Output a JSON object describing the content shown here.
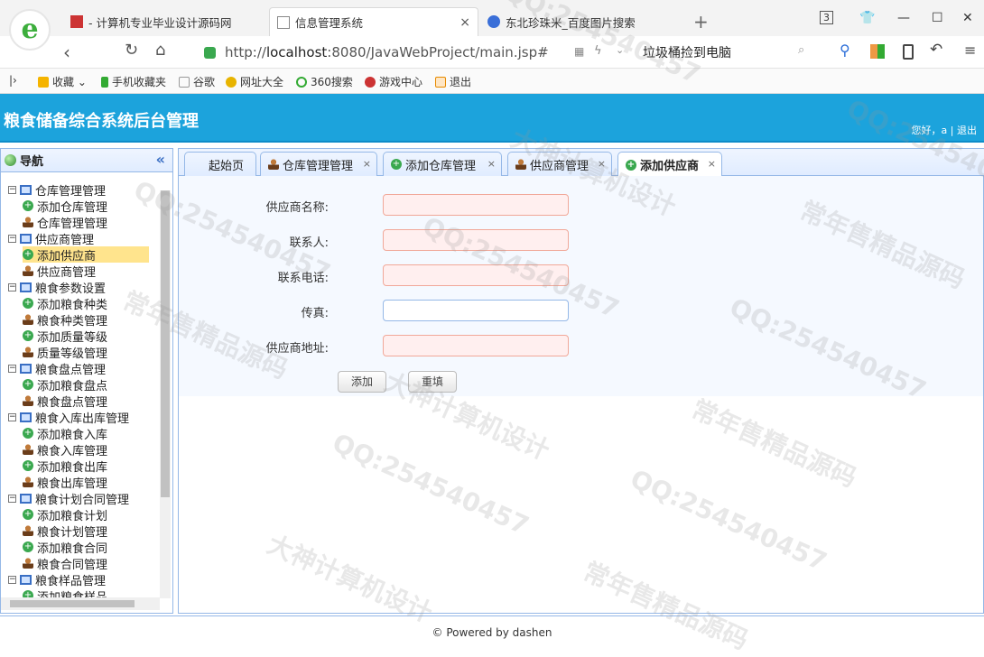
{
  "browser": {
    "tabs": [
      {
        "title": "- 计算机专业毕业设计源码网",
        "close": "×"
      },
      {
        "title": "信息管理系统",
        "close": "×"
      },
      {
        "title": "东北珍珠米_百度图片搜索",
        "close": ""
      }
    ],
    "new_tab": "+",
    "tab_count": "3",
    "url_prefix": "http://",
    "url_host": "localhost",
    "url_rest": ":8080/JavaWebProject/main.jsp#",
    "search_text": "垃圾桶捡到电脑"
  },
  "bookmarks": [
    "收藏",
    "手机收藏夹",
    "谷歌",
    "网址大全",
    "360搜索",
    "游戏中心",
    "退出"
  ],
  "app": {
    "title": "粮食储备综合系统后台管理",
    "greeting": "您好，a",
    "sep": "|",
    "logout": "退出"
  },
  "sidebar": {
    "title": "导航",
    "collapse": "«",
    "tree": [
      {
        "label": "仓库管理管理",
        "level": 0
      },
      {
        "label": "添加仓库管理",
        "level": 1,
        "icon": "plus"
      },
      {
        "label": "仓库管理管理",
        "level": 1,
        "icon": "user"
      },
      {
        "label": "供应商管理",
        "level": 0
      },
      {
        "label": "添加供应商",
        "level": 1,
        "icon": "plus",
        "selected": true
      },
      {
        "label": "供应商管理",
        "level": 1,
        "icon": "user"
      },
      {
        "label": "粮食参数设置",
        "level": 0
      },
      {
        "label": "添加粮食种类",
        "level": 1,
        "icon": "plus"
      },
      {
        "label": "粮食种类管理",
        "level": 1,
        "icon": "user"
      },
      {
        "label": "添加质量等级",
        "level": 1,
        "icon": "plus"
      },
      {
        "label": "质量等级管理",
        "level": 1,
        "icon": "user"
      },
      {
        "label": "粮食盘点管理",
        "level": 0
      },
      {
        "label": "添加粮食盘点",
        "level": 1,
        "icon": "plus"
      },
      {
        "label": "粮食盘点管理",
        "level": 1,
        "icon": "user"
      },
      {
        "label": "粮食入库出库管理",
        "level": 0
      },
      {
        "label": "添加粮食入库",
        "level": 1,
        "icon": "plus"
      },
      {
        "label": "粮食入库管理",
        "level": 1,
        "icon": "user"
      },
      {
        "label": "添加粮食出库",
        "level": 1,
        "icon": "plus"
      },
      {
        "label": "粮食出库管理",
        "level": 1,
        "icon": "user"
      },
      {
        "label": "粮食计划合同管理",
        "level": 0
      },
      {
        "label": "添加粮食计划",
        "level": 1,
        "icon": "plus"
      },
      {
        "label": "粮食计划管理",
        "level": 1,
        "icon": "user"
      },
      {
        "label": "添加粮食合同",
        "level": 1,
        "icon": "plus"
      },
      {
        "label": "粮食合同管理",
        "level": 1,
        "icon": "user"
      },
      {
        "label": "粮食样品管理",
        "level": 0
      },
      {
        "label": "添加粮食样品",
        "level": 1,
        "icon": "plus"
      }
    ]
  },
  "content_tabs": [
    {
      "label": "起始页",
      "icon": "",
      "close": ""
    },
    {
      "label": "仓库管理管理",
      "icon": "user",
      "close": "×"
    },
    {
      "label": "添加仓库管理",
      "icon": "plus",
      "close": "×"
    },
    {
      "label": "供应商管理",
      "icon": "user",
      "close": "×"
    },
    {
      "label": "添加供应商",
      "icon": "plus",
      "close": "×",
      "active": true
    }
  ],
  "form": {
    "fields": [
      {
        "label": "供应商名称:",
        "value": "",
        "required": true
      },
      {
        "label": "联系人:",
        "value": "",
        "required": true
      },
      {
        "label": "联系电话:",
        "value": "",
        "required": true
      },
      {
        "label": "传真:",
        "value": "",
        "required": false
      },
      {
        "label": "供应商地址:",
        "value": "",
        "required": true
      }
    ],
    "submit": "添加",
    "reset": "重填"
  },
  "footer": "© Powered by dashen",
  "watermarks": [
    "QQ:254540457",
    "常年售精品源码",
    "大神计算机设计"
  ],
  "colors": {
    "header": "#1ca3dc",
    "border": "#95b8e7",
    "selected": "#ffe48d",
    "invalid_bg": "#ffefef"
  }
}
